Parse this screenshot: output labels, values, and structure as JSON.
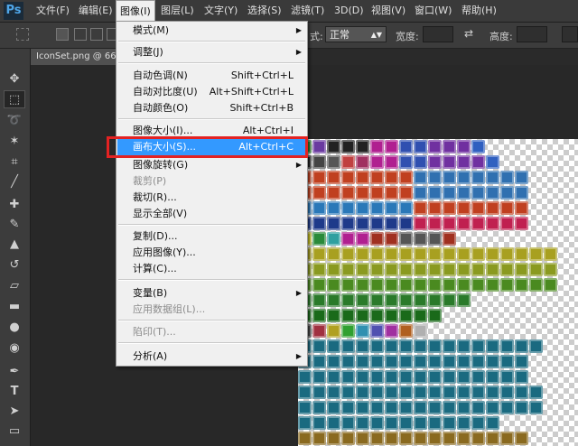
{
  "app": {
    "logo": "Ps"
  },
  "menubar": {
    "items": [
      "文件(F)",
      "编辑(E)",
      "图像(I)",
      "图层(L)",
      "文字(Y)",
      "选择(S)",
      "滤镜(T)",
      "3D(D)",
      "视图(V)",
      "窗口(W)",
      "帮助(H)"
    ],
    "active": "图像(I)"
  },
  "options": {
    "style_label": "式:",
    "style_value": "正常",
    "width_label": "宽度:",
    "height_label": "高度:"
  },
  "document": {
    "tab_title": "IconSet.png @ 66."
  },
  "image_menu": {
    "items": [
      {
        "label": "模式(M)",
        "shortcut": "",
        "submenu": true,
        "disabled": false
      },
      {
        "label": "调整(J)",
        "shortcut": "",
        "submenu": true,
        "disabled": false
      },
      {
        "label": "自动色调(N)",
        "shortcut": "Shift+Ctrl+L",
        "submenu": false,
        "disabled": false
      },
      {
        "label": "自动对比度(U)",
        "shortcut": "Alt+Shift+Ctrl+L",
        "submenu": false,
        "disabled": false
      },
      {
        "label": "自动颜色(O)",
        "shortcut": "Shift+Ctrl+B",
        "submenu": false,
        "disabled": false
      },
      {
        "label": "图像大小(I)...",
        "shortcut": "Alt+Ctrl+I",
        "submenu": false,
        "disabled": false
      },
      {
        "label": "画布大小(S)...",
        "shortcut": "Alt+Ctrl+C",
        "submenu": false,
        "disabled": false,
        "highlighted": true
      },
      {
        "label": "图像旋转(G)",
        "shortcut": "",
        "submenu": true,
        "disabled": false
      },
      {
        "label": "裁剪(P)",
        "shortcut": "",
        "submenu": false,
        "disabled": true
      },
      {
        "label": "裁切(R)...",
        "shortcut": "",
        "submenu": false,
        "disabled": false
      },
      {
        "label": "显示全部(V)",
        "shortcut": "",
        "submenu": false,
        "disabled": false
      },
      {
        "label": "复制(D)...",
        "shortcut": "",
        "submenu": false,
        "disabled": false
      },
      {
        "label": "应用图像(Y)...",
        "shortcut": "",
        "submenu": false,
        "disabled": false
      },
      {
        "label": "计算(C)...",
        "shortcut": "",
        "submenu": false,
        "disabled": false
      },
      {
        "label": "变量(B)",
        "shortcut": "",
        "submenu": true,
        "disabled": false
      },
      {
        "label": "应用数据组(L)...",
        "shortcut": "",
        "submenu": false,
        "disabled": true
      },
      {
        "label": "陷印(T)...",
        "shortcut": "",
        "submenu": false,
        "disabled": true
      },
      {
        "label": "分析(A)",
        "shortcut": "",
        "submenu": true,
        "disabled": false
      }
    ]
  },
  "tools": [
    "move-icon",
    "marquee-icon",
    "lasso-icon",
    "magic-wand-icon",
    "crop-icon",
    "eyedropper-icon",
    "healing-brush-icon",
    "brush-icon",
    "stamp-icon",
    "history-brush-icon",
    "eraser-icon",
    "gradient-icon",
    "blur-icon",
    "dodge-icon",
    "pen-icon",
    "type-icon",
    "path-select-icon",
    "rectangle-icon"
  ],
  "colors": {
    "highlight": "#3399ff",
    "annotation": "#e32222"
  }
}
